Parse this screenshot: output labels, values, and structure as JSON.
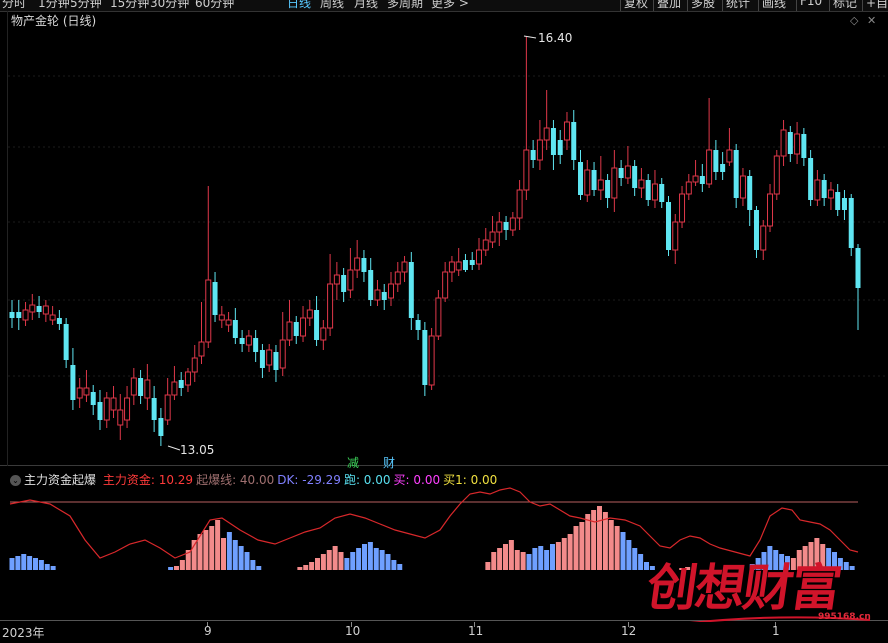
{
  "toolbar": {
    "periods": [
      "分时",
      "1分钟",
      "5分钟",
      "15分钟",
      "30分钟",
      "60分钟",
      "日线",
      "周线",
      "月线",
      "多周期",
      "更多 >"
    ],
    "active_period": "日线",
    "right_buttons": [
      "复权",
      "叠加",
      "多股",
      "统计",
      "画线",
      "F10",
      "标记",
      "+自"
    ]
  },
  "main_chart": {
    "title": "物产金轮 (日线)",
    "high_label": "16.40",
    "low_label": "13.05",
    "markers": [
      {
        "text": "减",
        "color": "#3cd35a"
      },
      {
        "text": "财",
        "color": "#59c9ff"
      }
    ],
    "colors": {
      "up": "#e0384a",
      "down": "#5fe6f2"
    }
  },
  "indicator": {
    "name": "主力资金起爆",
    "fields": [
      {
        "label": "主力资金:",
        "value": "10.29",
        "color": "#ff3a3a"
      },
      {
        "label": "起爆线:",
        "value": "40.00",
        "color": "#a07070"
      },
      {
        "label": "DK:",
        "value": "-29.29",
        "color": "#8080ff"
      },
      {
        "label": "跑:",
        "value": "0.00",
        "color": "#59e0f0"
      },
      {
        "label": "买:",
        "value": "0.00",
        "color": "#ff40ff"
      },
      {
        "label": "买1:",
        "value": "0.00",
        "color": "#f0e040"
      }
    ],
    "bar_colors": {
      "pos": "#f38b8b",
      "neg": "#6fa0ff"
    },
    "line_color": "#d8282b",
    "threshold_color": "#b86060"
  },
  "xaxis": {
    "labels": [
      "2023年",
      "9",
      "10",
      "11",
      "12",
      "1"
    ]
  },
  "watermark": {
    "text": "创想财富",
    "url": "995168.cn"
  }
}
